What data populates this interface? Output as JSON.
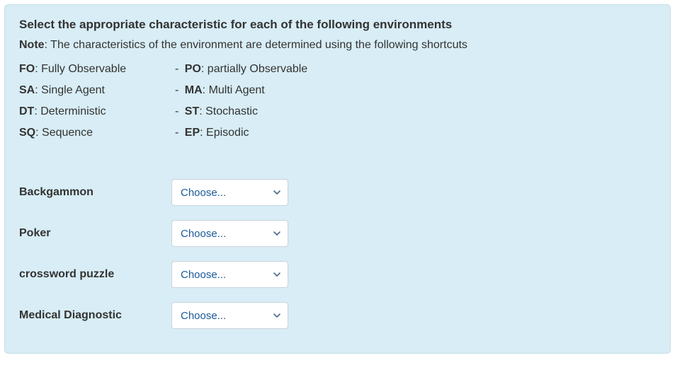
{
  "heading": "Select the appropriate characteristic for each of the following environments",
  "note": {
    "label": "Note",
    "text": ": The characteristics of the environment are determined using the following shortcuts"
  },
  "definitions": [
    {
      "a1": "FO",
      "t1": ": Fully Observable",
      "sep": "  -  ",
      "a2": "PO",
      "t2": ": partially Observable"
    },
    {
      "a1": "SA",
      "t1": ": Single Agent",
      "sep": "- ",
      "a2": "MA",
      "t2": ": Multi Agent"
    },
    {
      "a1": "DT",
      "t1": ": Deterministic",
      "sep": "- ",
      "a2": "ST",
      "t2": ": Stochastic"
    },
    {
      "a1": "SQ",
      "t1": ": Sequence",
      "sep": "- ",
      "a2": "EP",
      "t2": ": Episodic"
    }
  ],
  "select_placeholder": "Choose...",
  "questions": [
    {
      "label": "Backgammon"
    },
    {
      "label": "Poker"
    },
    {
      "label": "crossword puzzle"
    },
    {
      "label": "Medical Diagnostic"
    }
  ]
}
